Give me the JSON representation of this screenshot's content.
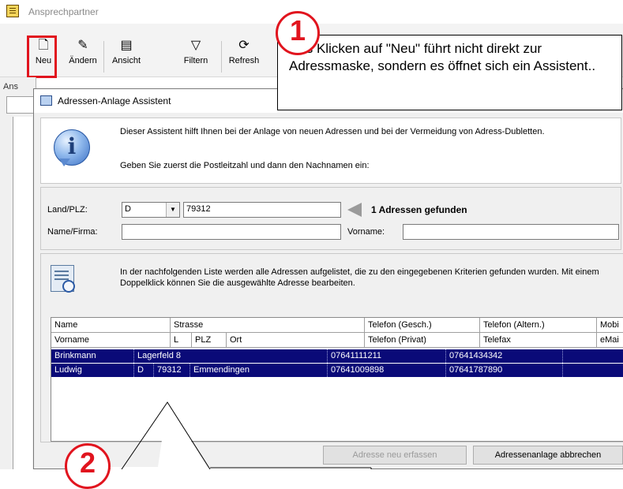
{
  "main_window": {
    "title": "Ansprechpartner",
    "toolbar": [
      {
        "label": "Neu",
        "icon": "new-document-icon"
      },
      {
        "label": "Ändern",
        "icon": "edit-document-icon"
      },
      {
        "label": "Ansicht",
        "icon": "view-icon"
      },
      {
        "label": "Filtern",
        "icon": "filter-icon"
      },
      {
        "label": "Refresh",
        "icon": "refresh-icon"
      }
    ],
    "left_label": "Ans"
  },
  "dialog": {
    "title": "Adressen-Anlage Assistent",
    "intro_text": "Dieser Assistent hilft Ihnen bei der Anlage von neuen Adressen und bei der Vermeidung von Adress-Dubletten.",
    "intro_hint": "Geben Sie zuerst die Postleitzahl und dann den Nachnamen ein:",
    "form": {
      "land_plz_label": "Land/PLZ:",
      "land_value": "D",
      "plz_value": "79312",
      "found_text": "1 Adressen gefunden",
      "name_label": "Name/Firma:",
      "name_value": "",
      "vorname_label": "Vorname:",
      "vorname_value": ""
    },
    "list_text": "In der nachfolgenden Liste werden alle Adressen aufgelistet, die zu den eingegebenen Kriterien gefunden wurden. Mit einem Doppelklick können Sie die ausgewählte Adresse bearbeiten.",
    "table": {
      "header_row1": [
        "Name",
        "Strasse",
        "Telefon (Gesch.)",
        "Telefon (Altern.)",
        "Mobi"
      ],
      "header_row2": [
        "Vorname",
        "L",
        "PLZ",
        "Ort",
        "Telefon (Privat)",
        "Telefax",
        "eMai"
      ],
      "rows": [
        {
          "name": "Brinkmann",
          "strasse": "Lagerfeld 8",
          "tel_gesch": "07641111211",
          "tel_altern": "07641434342",
          "mobil": ""
        },
        {
          "name": "Ludwig",
          "land": "D",
          "plz": "79312",
          "ort": "Emmendingen",
          "tel_privat": "07641009898",
          "telefax": "07641787890",
          "email": ""
        }
      ]
    },
    "buttons": {
      "new_address": "Adresse neu erfassen",
      "cancel": "Adressenanlage abbrechen"
    }
  },
  "callouts": {
    "step1_number": "1",
    "step1_text": "Das Klicken auf  \"Neu\" führt nicht direkt zur  Adressmaske, sondern es öffnet sich ein Assistent..",
    "step2_number": "2"
  },
  "colors": {
    "selection": "#0a0a78",
    "highlight_red": "#e1141e"
  }
}
